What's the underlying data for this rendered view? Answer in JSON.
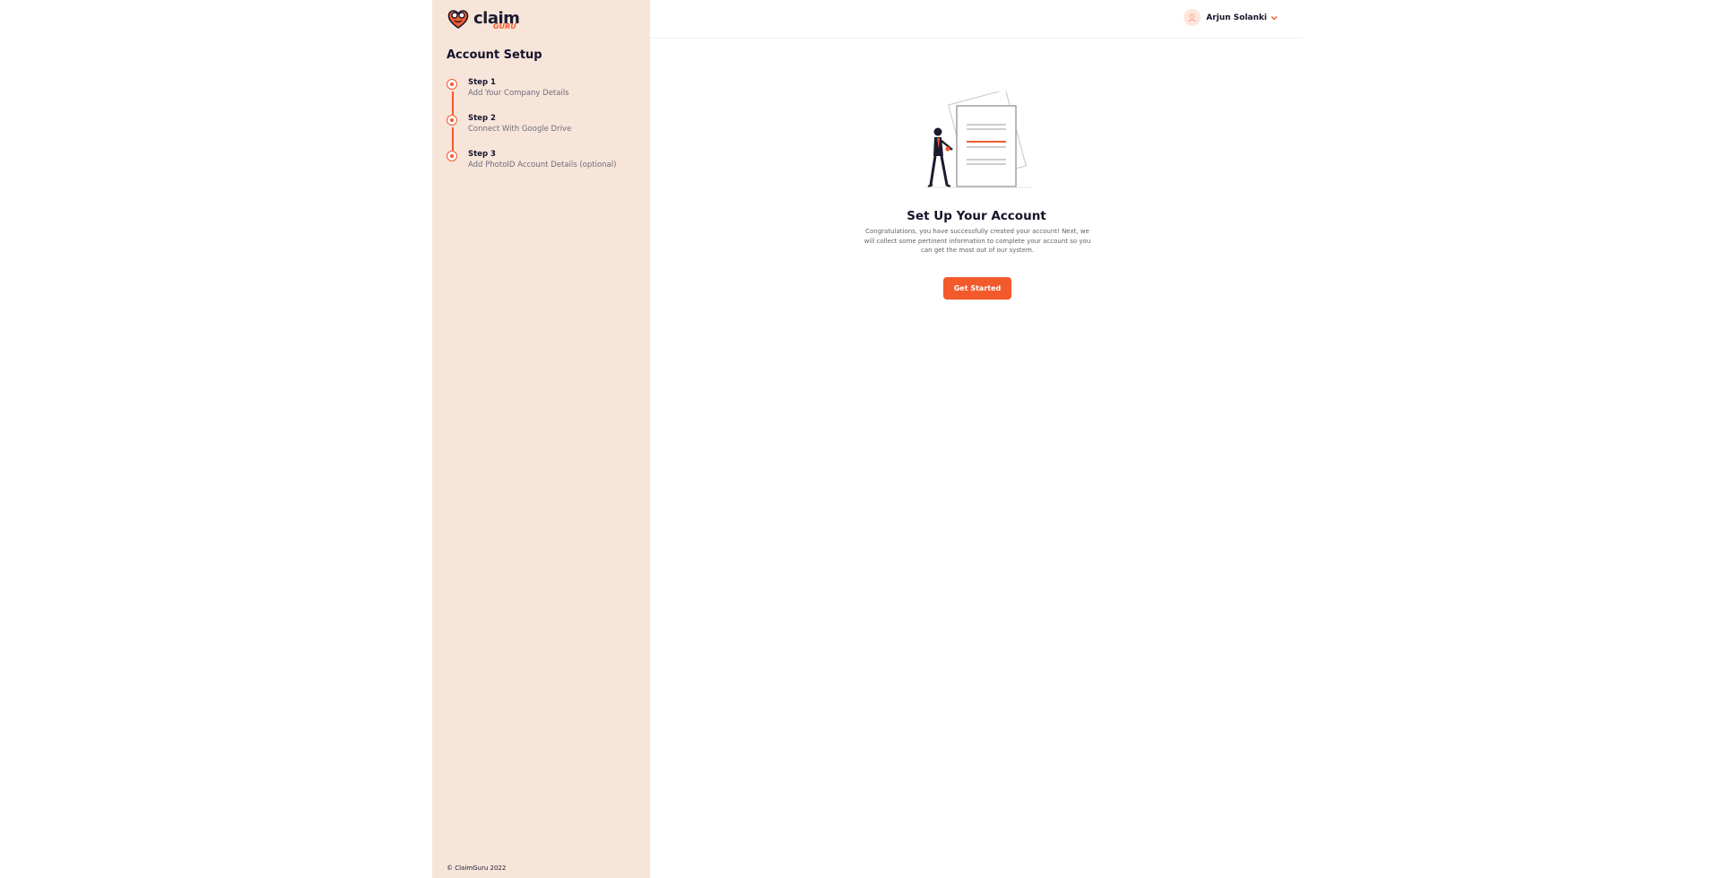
{
  "brand": {
    "name": "claim",
    "sub": "GURU"
  },
  "sidebar": {
    "title": "Account Setup",
    "steps": [
      {
        "title": "Step 1",
        "description": "Add Your Company Details"
      },
      {
        "title": "Step 2",
        "description": "Connect With Google Drive"
      },
      {
        "title": "Step 3",
        "description": "Add PhotoID Account Details (optional)"
      }
    ],
    "copyright": "© ClaimGuru 2022"
  },
  "header": {
    "user_name": "Arjun Solanki"
  },
  "main": {
    "title": "Set Up Your Account",
    "description": "Congratulations, you have successfully created your account! Next, we will collect some pertinent information to complete your account so you can get the most out of our system.",
    "cta_label": "Get Started"
  },
  "colors": {
    "accent": "#f25a2c",
    "sidebar_bg": "#f8e5da",
    "text_dark": "#14142b"
  },
  "icons": {
    "logo": "heart-logo-icon",
    "avatar": "user-avatar-icon",
    "dropdown": "chevron-down-icon"
  }
}
